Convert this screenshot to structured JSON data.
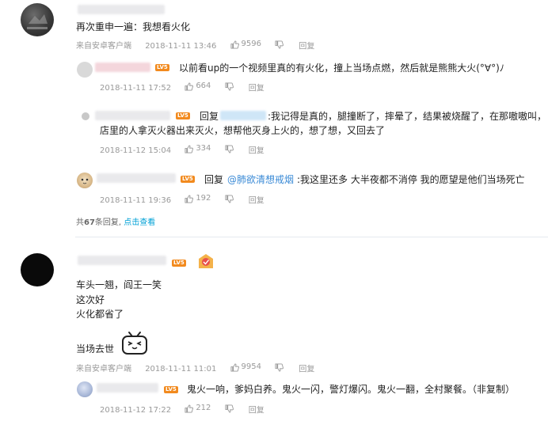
{
  "thread1": {
    "comment": {
      "text": "再次重申一遍：我想看火化",
      "meta": {
        "client": "来自安卓客户端",
        "time": "2018-11-11 13:46",
        "likes": "9596",
        "reply": "回复"
      }
    },
    "replies": [
      {
        "level": "LV5",
        "text": "以前看up的一个视频里真的有火化，撞上当场点燃，然后就是熊熊大火(°∀°)ﾉ",
        "meta": {
          "time": "2018-11-11 17:52",
          "likes": "664",
          "reply": "回复"
        }
      },
      {
        "level": "LV5",
        "reply_prefix": "回复",
        "text_line1": ":我记得是真的，腿撞断了，摔晕了，结果被烧醒了，在那嗷嗷叫，",
        "text_line2": "店里的人拿灭火器出来灭火，想帮他灭身上火的，想了想，又回去了",
        "meta": {
          "time": "2018-11-12 15:04",
          "likes": "334",
          "reply": "回复"
        }
      },
      {
        "level": "LV5",
        "reply_prefix": "回复",
        "mention": "@肺欲清想戒烟",
        "text": ":我这里还多 大半夜都不消停 我的愿望是他们当场死亡",
        "meta": {
          "time": "2018-11-11 19:36",
          "likes": "192",
          "reply": "回复"
        }
      }
    ],
    "total": {
      "prefix": "共",
      "count": "67",
      "suffix": "条回复,",
      "more": "点击查看"
    }
  },
  "thread2": {
    "level": "LV5",
    "lines": [
      "车头一翘，阎王一笑",
      "这次好",
      "火化都省了"
    ],
    "last_line": "当场去世",
    "meta": {
      "client": "来自安卓客户端",
      "time": "2018-11-11 11:01",
      "likes": "9954",
      "reply": "回复"
    },
    "reply": {
      "level": "LV5",
      "text": "鬼火一响，爹妈白养。鬼火一闪，警灯爆闪。鬼火一翻，全村聚餐。（非复制）",
      "meta": {
        "time": "2018-11-12 17:22",
        "likes": "212",
        "reply": "回复"
      }
    }
  },
  "colors": {
    "accent": "#00a1d6",
    "level_badge": "#f28a1e",
    "meta_text": "#999999",
    "mention": "#3a8ad6"
  }
}
